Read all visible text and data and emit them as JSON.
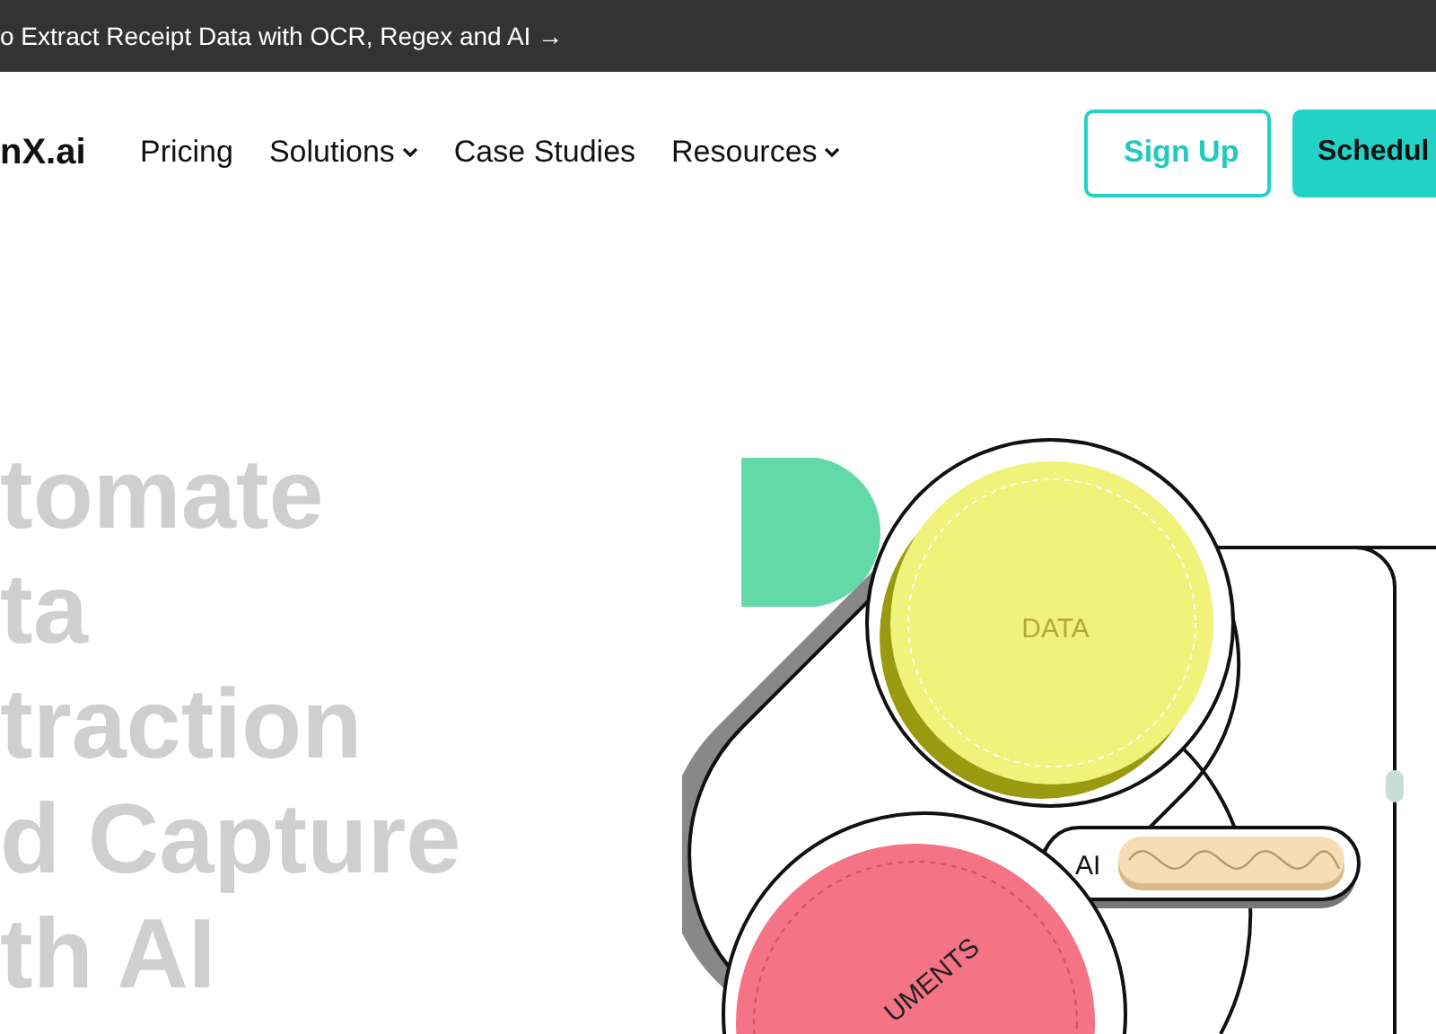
{
  "announcement": {
    "text": "o Extract Receipt Data with OCR, Regex and AI →"
  },
  "nav": {
    "logo": "nX.ai",
    "links": [
      {
        "label": "Pricing",
        "kind": "link"
      },
      {
        "label": "Solutions",
        "kind": "dropdown"
      },
      {
        "label": "Case Studies",
        "kind": "link"
      },
      {
        "label": "Resources",
        "kind": "dropdown"
      }
    ],
    "buttons": [
      {
        "label": "Sign Up",
        "kind": "outline"
      },
      {
        "label": "Schedul",
        "kind": "filled"
      }
    ]
  },
  "hero": {
    "headline": [
      "tomate",
      "ta",
      "traction",
      "d Capture",
      "th AI"
    ]
  },
  "diagram": {
    "data_label": "DATA",
    "ai_label": "AI",
    "documents_label": "UMENTS"
  }
}
